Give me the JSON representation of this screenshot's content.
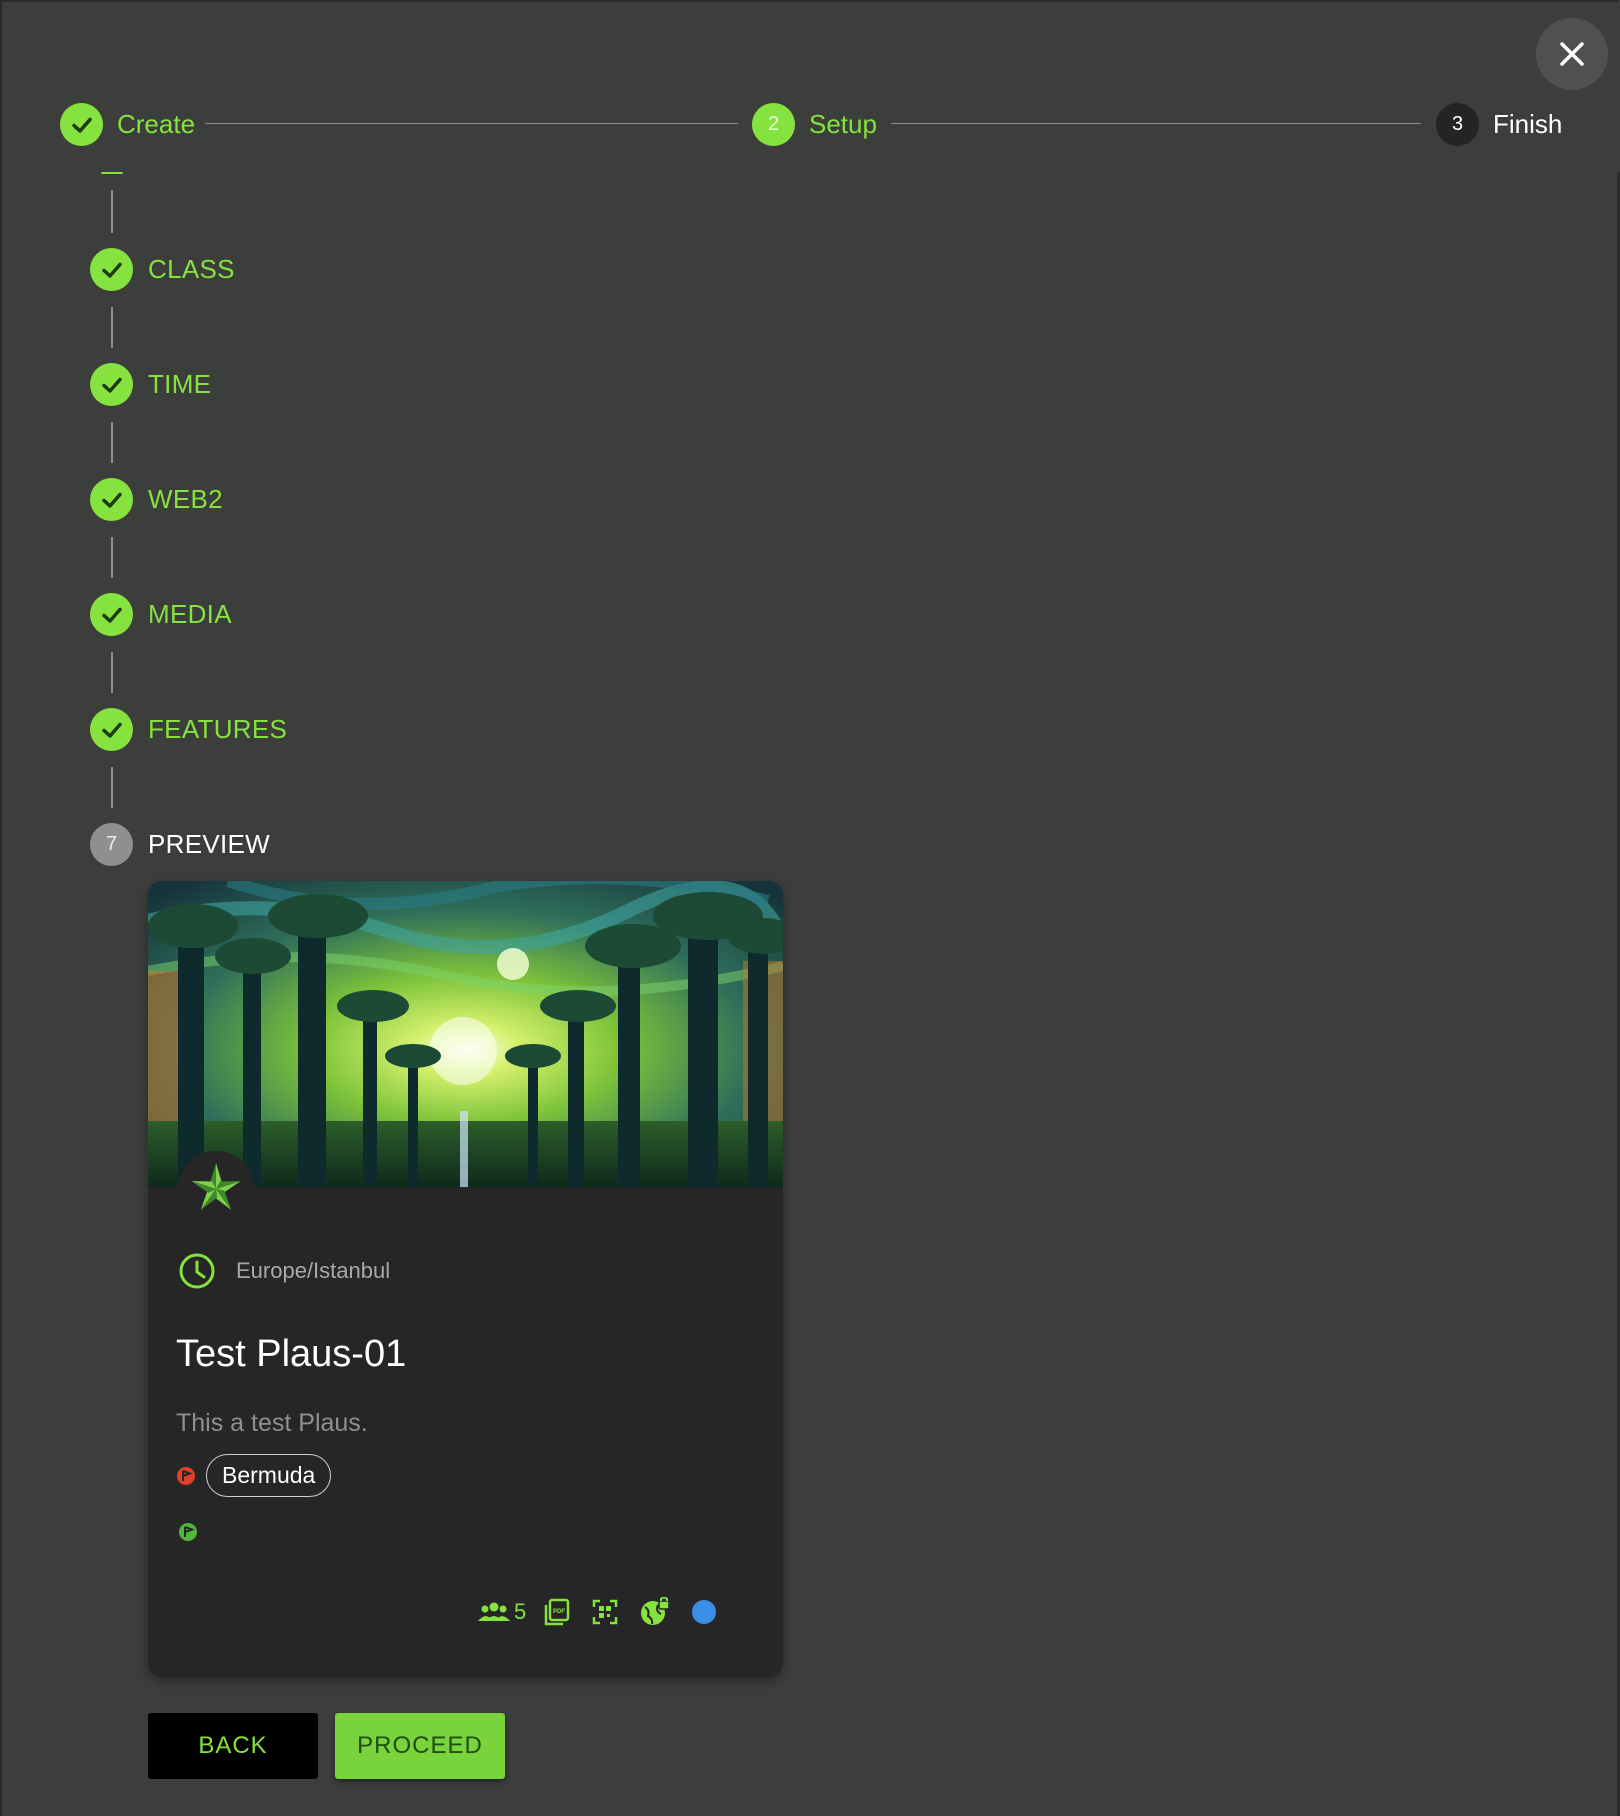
{
  "stepper": {
    "steps": [
      {
        "label": "Create",
        "number": "",
        "state": "done"
      },
      {
        "label": "Setup",
        "number": "2",
        "state": "active"
      },
      {
        "label": "Finish",
        "number": "3",
        "state": "todo"
      }
    ]
  },
  "substeps": [
    {
      "label": "CLASS",
      "state": "done"
    },
    {
      "label": "TIME",
      "state": "done"
    },
    {
      "label": "WEB2",
      "state": "done"
    },
    {
      "label": "MEDIA",
      "state": "done"
    },
    {
      "label": "FEATURES",
      "state": "done"
    },
    {
      "label": "PREVIEW",
      "number": "7",
      "state": "active"
    }
  ],
  "preview": {
    "timezone": "Europe/Istanbul",
    "title": "Test Plaus-01",
    "description": "This a test Plaus.",
    "location_chip": "Bermuda",
    "participants_count": "5",
    "icons": [
      "group-icon",
      "pdf-icon",
      "qr-code-icon",
      "globe-lock-icon",
      "blue-status-dot"
    ]
  },
  "actions": {
    "back_label": "BACK",
    "proceed_label": "PROCEED"
  },
  "colors": {
    "accent": "#86e23f",
    "background": "#3c3e3b",
    "card": "#262626",
    "status_blue": "#3a8ee6",
    "flag_red": "#e0402a"
  }
}
